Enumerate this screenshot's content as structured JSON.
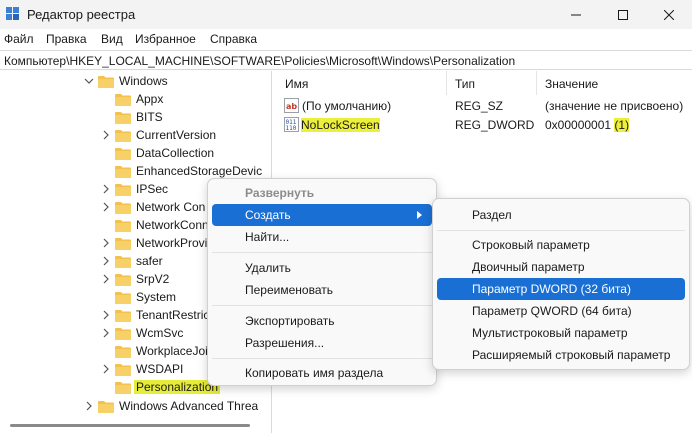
{
  "window": {
    "title": "Редактор реестра",
    "icon": "regedit-icon"
  },
  "menubar": [
    "Файл",
    "Правка",
    "Вид",
    "Избранное",
    "Справка"
  ],
  "address": "Компьютер\\HKEY_LOCAL_MACHINE\\SOFTWARE\\Policies\\Microsoft\\Windows\\Personalization",
  "tree": {
    "parent": "Windows",
    "children": [
      {
        "label": "Appx",
        "expandable": false
      },
      {
        "label": "BITS",
        "expandable": false
      },
      {
        "label": "CurrentVersion",
        "expandable": true
      },
      {
        "label": "DataCollection",
        "expandable": false
      },
      {
        "label": "EnhancedStorageDevic",
        "expandable": false
      },
      {
        "label": "IPSec",
        "expandable": true
      },
      {
        "label": "Network Con",
        "expandable": true
      },
      {
        "label": "NetworkConn",
        "expandable": false
      },
      {
        "label": "NetworkProvi",
        "expandable": true
      },
      {
        "label": "safer",
        "expandable": true
      },
      {
        "label": "SrpV2",
        "expandable": true
      },
      {
        "label": "System",
        "expandable": false
      },
      {
        "label": "TenantRestrict",
        "expandable": true
      },
      {
        "label": "WcmSvc",
        "expandable": true
      },
      {
        "label": "WorkplaceJoi",
        "expandable": false
      },
      {
        "label": "WSDAPI",
        "expandable": true
      },
      {
        "label": "Personalization",
        "expandable": false,
        "selected": true
      }
    ],
    "sibling": "Windows Advanced Threa"
  },
  "list": {
    "headers": {
      "name": "Имя",
      "type": "Тип",
      "value": "Значение"
    },
    "rows": [
      {
        "icon": "string-value-icon",
        "name": "(По умолчанию)",
        "type": "REG_SZ",
        "value": "(значение не присвоено)",
        "value_suffix": ""
      },
      {
        "icon": "binary-value-icon",
        "name": "NoLockScreen",
        "type": "REG_DWORD",
        "value": "0x00000001 ",
        "value_suffix": "(1)"
      }
    ]
  },
  "context_menu": {
    "items": [
      {
        "label": "Развернуть",
        "disabled": true
      },
      {
        "label": "Создать",
        "submenu": true,
        "active": true
      },
      {
        "label": "Найти..."
      },
      {
        "label": "Удалить"
      },
      {
        "label": "Переименовать"
      },
      {
        "label": "Экспортировать"
      },
      {
        "label": "Разрешения..."
      },
      {
        "label": "Копировать имя раздела"
      }
    ]
  },
  "submenu": {
    "items": [
      {
        "label": "Раздел"
      },
      {
        "label": "Строковый параметр"
      },
      {
        "label": "Двоичный параметр"
      },
      {
        "label": "Параметр DWORD (32 бита)",
        "active": true
      },
      {
        "label": "Параметр QWORD (64 бита)"
      },
      {
        "label": "Мультистроковый параметр"
      },
      {
        "label": "Расширяемый строковый параметр"
      }
    ]
  },
  "colors": {
    "highlight": "#ecf03b",
    "menu_active": "#1a6fd4",
    "folder": "#f2c14e"
  }
}
